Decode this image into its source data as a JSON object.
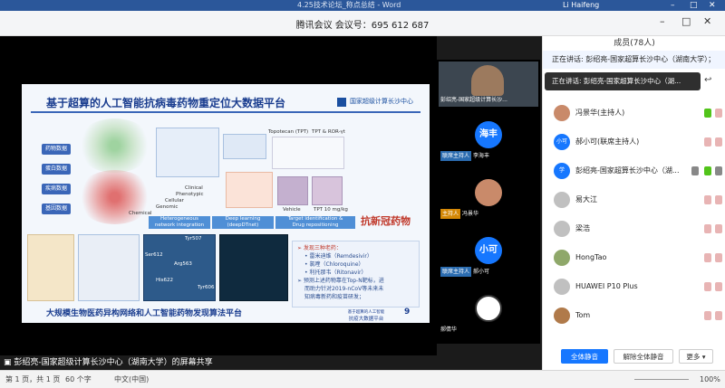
{
  "word": {
    "title": "4.25技术论坛_称点总结 - Word",
    "user": "Li Haifeng"
  },
  "meeting": {
    "title": "腾讯会议 会议号：695 612 687"
  },
  "slide": {
    "title": "基于超算的人工智能抗病毒药物重定位大数据平台",
    "org": "国家超级计算长沙中心",
    "left_labels": [
      "药物数据",
      "蛋白数据",
      "疾病数据",
      "基因数据"
    ],
    "pills": [
      {
        "l1": "Heterogeneous",
        "l2": "network integration"
      },
      {
        "l1": "Deep learning",
        "l2": "(deepDTnet)"
      },
      {
        "l1": "Target identification &",
        "l2": "Drug repositioning"
      }
    ],
    "big_red": "抗新冠药物",
    "texts": {
      "clinical": "Clinical",
      "phenotypic": "Phenotypic",
      "cellular": "Cellular",
      "genomic": "Genomic",
      "chemical": "Chemical",
      "topo": "Topotecan (TPT)",
      "ror": "TPT & ROR-γt",
      "vehicle": "Vehicle",
      "tpt10": "TPT 10 mg/kg",
      "tyr507": "Tyr507",
      "ser612": "Ser612",
      "arg563": "Arg563",
      "his622": "His622",
      "tyr606": "Tyr606"
    },
    "box": [
      "➢ 发现三种老药：",
      "• 雷米迪维（Remdesivir）",
      "• 氯喹（Chloroquine）",
      "• 利托那韦（Ritonavir）",
      "➢ 预测上述药物靠在Top-N靶标，进",
      "而助力针对2019-nCoV等未来未",
      "知病毒新药和疫苗研发；"
    ],
    "bottom_caption": "大规模生物医药异构网络和人工智能药物发现算法平台",
    "small_cap_1": "基于超算的人工智能",
    "small_cap_2": "抗疫大数据平台",
    "page_no": "9"
  },
  "share_status": "彭绍亮-国家超级计算长沙中心（湖南大学）的屏幕共享",
  "videos": [
    {
      "name": "彭绍亮-国家超级计算长沙...",
      "avatar": "",
      "color": "#8a6a50",
      "tag": ""
    },
    {
      "name": "李海丰",
      "avatar": "海丰",
      "color": "#1677ff",
      "tag": "联席主持人"
    },
    {
      "name": "冯景华",
      "avatar": "",
      "color": "#c98a6a",
      "tag": "主持人"
    },
    {
      "name": "郝小可",
      "avatar": "小可",
      "color": "#1677ff",
      "tag": "联席主持人"
    },
    {
      "name": "郝倩华",
      "avatar": "",
      "color": "#ffffff",
      "tag": ""
    }
  ],
  "panel": {
    "header": "成员(78人)",
    "speaking": "正在讲话: 彭绍亮-国家超算长沙中心（湖南大学）；",
    "tooltip": "正在讲话: 彭绍亮-国家超算长沙中心（湖...",
    "members": [
      {
        "name": "冯景华(主持人)",
        "av": "",
        "color": "#c98a6a"
      },
      {
        "name": "郝小可(联席主持人)",
        "av": "小可",
        "color": "#1677ff"
      },
      {
        "name": "彭绍亮-国家超算长沙中心（湖...",
        "av": "学",
        "color": "#1677ff"
      },
      {
        "name": "易大江",
        "av": "",
        "color": "#c0c0c0"
      },
      {
        "name": "梁浩",
        "av": "",
        "color": "#c0c0c0"
      },
      {
        "name": "HongTao",
        "av": "",
        "color": "#8fa86a"
      },
      {
        "name": "HUAWEI P10 Plus",
        "av": "",
        "color": "#c0c0c0"
      },
      {
        "name": "Tom",
        "av": "",
        "color": "#b07a4a"
      }
    ],
    "btn_mute_all": "全体静音",
    "btn_unmute_all": "解除全体静音",
    "btn_more": "更多 ▾"
  },
  "status": {
    "page": "第 1 页，共 1 页",
    "words": "60 个字",
    "lang": "中文(中国)",
    "zoom": "100%"
  }
}
